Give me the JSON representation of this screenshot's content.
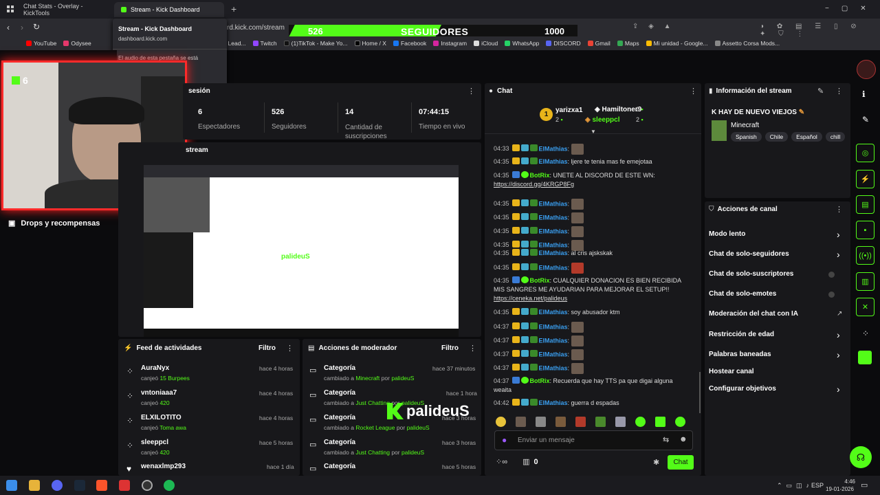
{
  "browser": {
    "tabs": [
      {
        "title": "Chat Stats - Overlay - KickTools"
      },
      {
        "title": "Stream - Kick Dashboard"
      }
    ],
    "url": "rd.kick.com/stream",
    "tooltip": {
      "title": "Stream - Kick Dashboard",
      "url": "dashboard.kick.com",
      "audio": "El audio de esta pestaña se está"
    },
    "bookmarks": [
      "YouTube",
      "Odysee",
      "t Stats, Lead...",
      "Twitch",
      "(1)TikTok - Make Yo...",
      "Home / X",
      "Facebook",
      "Instagram",
      "iCloud",
      "WhatsApp",
      "DISCORD",
      "Gmail",
      "Maps",
      "Mi unidad - Google...",
      "Assetto Corsa Mods..."
    ]
  },
  "overlay": {
    "current": "526",
    "label": "SEGUIDORES",
    "goal": "1000",
    "logo": "palideuS",
    "cam_count": "6"
  },
  "session": {
    "title": "sesión",
    "stats": [
      {
        "value": "6",
        "label": "Espectadores"
      },
      {
        "value": "526",
        "label": "Seguidores"
      },
      {
        "value": "14",
        "label": "Cantidad de suscripciones"
      },
      {
        "value": "07:44:15",
        "label": "Tiempo en vivo"
      }
    ]
  },
  "stream_panel": {
    "title": "stream"
  },
  "sidebar": {
    "drops": "Drops y recompensas"
  },
  "activity": {
    "title": "Feed de actividades",
    "filter": "Filtro",
    "items": [
      {
        "user": "AuraNyx",
        "action": "canjeó",
        "reward": "15 Burpees",
        "time": "hace 4 horas"
      },
      {
        "user": "vntoniaaa7",
        "action": "canjeó",
        "reward": "420",
        "time": "hace 4 horas"
      },
      {
        "user": "ELXILOTITO",
        "action": "canjeó",
        "reward": "Toma awa",
        "time": "hace 4 horas"
      },
      {
        "user": "sleeppcl",
        "action": "canjeó",
        "reward": "420",
        "time": "hace 5 horas"
      },
      {
        "user": "wenaxlmp293",
        "action": "",
        "reward": "",
        "time": "hace 1 día"
      }
    ]
  },
  "modactions": {
    "title": "Acciones de moderador",
    "filter": "Filtro",
    "items": [
      {
        "title": "Categoría",
        "pre": "cambiado a",
        "value": "Minecraft",
        "by": "por",
        "user": "palideuS",
        "time": "hace 37 minutos"
      },
      {
        "title": "Categoría",
        "pre": "cambiado a",
        "value": "Just Chatting",
        "by": "por",
        "user": "palideuS",
        "time": "hace 1 hora"
      },
      {
        "title": "Categoría",
        "pre": "cambiado a",
        "value": "Rocket League",
        "by": "por",
        "user": "palideuS",
        "time": "hace 3 horas"
      },
      {
        "title": "Categoría",
        "pre": "cambiado a",
        "value": "Just Chatting",
        "by": "por",
        "user": "palideuS",
        "time": "hace 3 horas"
      },
      {
        "title": "Categoría",
        "pre": "",
        "value": "",
        "by": "",
        "user": "",
        "time": "hace 5 horas"
      }
    ]
  },
  "chat": {
    "title": "Chat",
    "top": [
      {
        "rank": "1",
        "name": "yarizxa1",
        "count": "2"
      },
      {
        "rank": "",
        "name": "Hamiltoner9",
        "count": "2"
      },
      {
        "rank": "",
        "name": "sleeppcl",
        "count": "2"
      }
    ],
    "messages": [
      {
        "time": "04:33",
        "user": "ElMathias",
        "text": ":",
        "emote": true,
        "bot": false
      },
      {
        "time": "04:35",
        "user": "ElMathias",
        "text": ": ljere te tenia mas fe emejotaa",
        "emote": false,
        "bot": false
      },
      {
        "time": "04:35",
        "user": "BotRix",
        "text": ": UNETE AL DISCORD DE ESTE WN:",
        "link": "https://discord.gg/4KRGP8Fg",
        "emote": false,
        "bot": true
      },
      {
        "time": "04:35",
        "user": "ElMathias",
        "text": ":",
        "emote": true,
        "bot": false
      },
      {
        "time": "04:35",
        "user": "ElMathias",
        "text": ":",
        "emote": true,
        "bot": false
      },
      {
        "time": "04:35",
        "user": "ElMathias",
        "text": ":",
        "emote": true,
        "bot": false
      },
      {
        "time": "04:35",
        "user": "ElMathias",
        "text": ":",
        "emote": true,
        "bot": false
      },
      {
        "time": "04:35",
        "user": "ElMathias",
        "text": ": al cris ajskskak",
        "emote": false,
        "bot": false
      },
      {
        "time": "04:35",
        "user": "ElMathias",
        "text": ":",
        "emote": true,
        "bot": false
      },
      {
        "time": "04:35",
        "user": "BotRix",
        "text": ": CUALQUIER DONACION ES BIEN RECIBIDA MIS SANGRES ME AYUDARIAN PARA MEJORAR EL SETUP!!",
        "link": "https://ceneka.net/palideus",
        "emote": false,
        "bot": true
      },
      {
        "time": "04:35",
        "user": "ElMathias",
        "text": ": soy abusador ktm",
        "emote": false,
        "bot": false
      },
      {
        "time": "04:37",
        "user": "ElMathias",
        "text": ":",
        "emote": true,
        "bot": false
      },
      {
        "time": "04:37",
        "user": "ElMathias",
        "text": ":",
        "emote": true,
        "bot": false
      },
      {
        "time": "04:37",
        "user": "ElMathias",
        "text": ":",
        "emote": true,
        "bot": false
      },
      {
        "time": "04:37",
        "user": "ElMathias",
        "text": ":",
        "emote": true,
        "bot": false
      },
      {
        "time": "04:37",
        "user": "BotRix",
        "text": ": Recuerda que hay TTS pa que digai alguna weaita",
        "emote": false,
        "bot": true
      },
      {
        "time": "04:42",
        "user": "ElMathias",
        "text": ": guerra d espadas",
        "emote": false,
        "bot": false
      }
    ],
    "input_placeholder": "Enviar un mensaje",
    "points": "0",
    "send": "Chat"
  },
  "info": {
    "title": "Información del stream",
    "stream_title": "K HAY DE NUEVO VIEJOS",
    "category": "Minecraft",
    "tags": [
      "Spanish",
      "Chile",
      "Español",
      "chill"
    ]
  },
  "actions": {
    "title": "Acciones de canal",
    "items": [
      {
        "label": "Modo lento",
        "control": "chevron"
      },
      {
        "label": "Chat de solo-seguidores",
        "control": "chevron"
      },
      {
        "label": "Chat de solo-suscriptores",
        "control": "toggle"
      },
      {
        "label": "Chat de solo-emotes",
        "control": "toggle"
      },
      {
        "label": "Moderación del chat con IA",
        "control": "external"
      },
      {
        "label": "Restricción de edad",
        "control": "chevron"
      },
      {
        "label": "Palabras baneadas",
        "control": "chevron"
      },
      {
        "label": "Hostear canal",
        "control": "none"
      },
      {
        "label": "Configurar objetivos",
        "control": "chevron"
      }
    ]
  },
  "taskbar": {
    "lang": "ESP",
    "time": "4:46",
    "date": "19-01-2026"
  },
  "colors": {
    "accent": "#53fc18",
    "panel": "#18181b",
    "bg": "#0b0b0d"
  }
}
